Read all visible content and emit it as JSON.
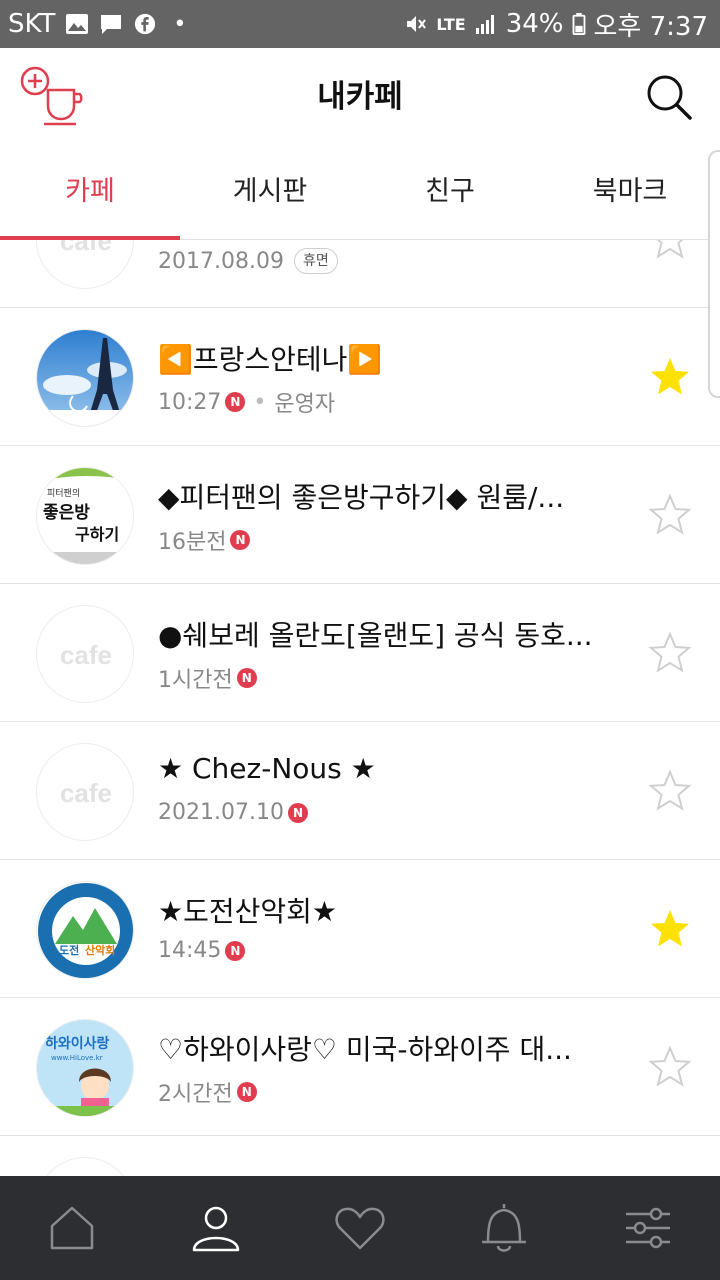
{
  "status_bar": {
    "carrier": "SKT",
    "network": "LTE",
    "battery": "34%",
    "time": "오후 7:37"
  },
  "header": {
    "title": "내카페"
  },
  "tabs": [
    {
      "label": "카페",
      "active": true
    },
    {
      "label": "게시판",
      "active": false
    },
    {
      "label": "친구",
      "active": false
    },
    {
      "label": "북마크",
      "active": false
    }
  ],
  "cafes": [
    {
      "name": "",
      "time": "2017.08.09",
      "status_badge": "휴면",
      "new": false,
      "favorite": false,
      "avatar": "cafe"
    },
    {
      "name": "◀️프랑스안테나▶️",
      "time": "10:27",
      "role": "운영자",
      "new": true,
      "favorite": true,
      "avatar": "eiffel"
    },
    {
      "name": "◆피터팬의 좋은방구하기◆ 원룸/...",
      "time": "16분전",
      "new": true,
      "favorite": false,
      "avatar": "peterpan",
      "avatar_text": [
        "피터팬의",
        "좋은방",
        "구하기"
      ]
    },
    {
      "name": "●쉐보레 올란도[올랜도] 공식 동호...",
      "time": "1시간전",
      "new": true,
      "favorite": false,
      "avatar": "cafe"
    },
    {
      "name": "★ Chez-Nous ★",
      "time": "2021.07.10",
      "new": true,
      "favorite": false,
      "avatar": "cafe"
    },
    {
      "name": "★도전산악회★",
      "time": "14:45",
      "new": true,
      "favorite": true,
      "avatar": "mountain",
      "avatar_text": [
        "도전",
        "산악회"
      ]
    },
    {
      "name": "♡하와이사랑♡ 미국-하와이주 대...",
      "time": "2시간전",
      "new": true,
      "favorite": false,
      "avatar": "hawaii",
      "avatar_text": [
        "하와이사랑",
        "www.HiLove.kr"
      ]
    },
    {
      "name": "",
      "time": "",
      "new": false,
      "favorite": false,
      "avatar": "cafe"
    }
  ],
  "placeholder_avatar_text": "cafe",
  "new_badge_text": "N",
  "bottom_nav": [
    {
      "icon": "home-icon",
      "active": false
    },
    {
      "icon": "person-icon",
      "active": true
    },
    {
      "icon": "heart-icon",
      "active": false
    },
    {
      "icon": "bell-icon",
      "active": false
    },
    {
      "icon": "settings-sliders-icon",
      "active": false
    }
  ],
  "colors": {
    "accent": "#e03e4e",
    "star_active": "#ffe100",
    "status_bar": "#646464",
    "bottom_nav": "#2d2e31"
  }
}
